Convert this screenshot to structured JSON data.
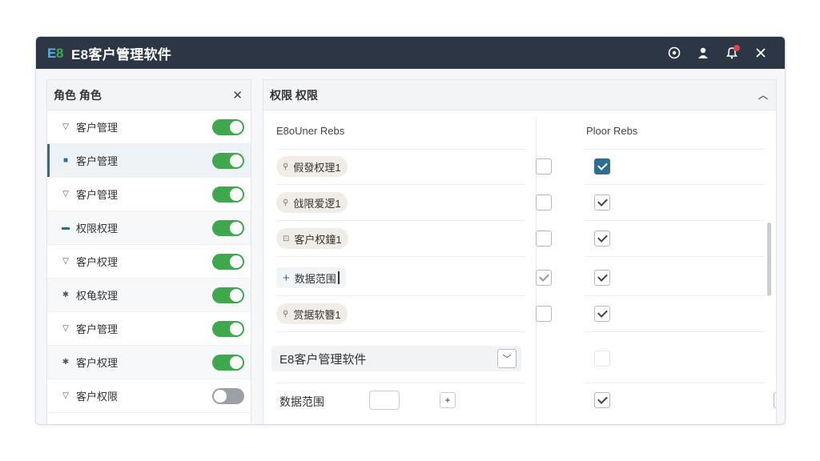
{
  "app": {
    "title": "E8客户管理软件",
    "logo_text": "E8"
  },
  "left_panel": {
    "header": "角色 角色",
    "close_icon": "close-icon",
    "roles": [
      {
        "label": "客户管理",
        "icon": "triangle-down-icon",
        "enabled": true
      },
      {
        "label": "客户管理",
        "icon": "square-icon",
        "enabled": true
      },
      {
        "label": "客户管理",
        "icon": "triangle-down-icon",
        "enabled": true
      },
      {
        "label": "权限权理",
        "icon": "flag-icon",
        "enabled": true
      },
      {
        "label": "客户权理",
        "icon": "triangle-down-icon",
        "enabled": true
      },
      {
        "label": "权龟软理",
        "icon": "star-icon",
        "enabled": true
      },
      {
        "label": "客户管理",
        "icon": "triangle-down-icon",
        "enabled": true
      },
      {
        "label": "客户权理",
        "icon": "star-icon",
        "enabled": true
      },
      {
        "label": "客户权限",
        "icon": "triangle-down-icon",
        "enabled": false
      }
    ]
  },
  "right_panel": {
    "header": "权限 权限",
    "col1_header": "E8oUner Rebs",
    "col2_header": "Ploor Rebs",
    "permissions": [
      {
        "label": "假發权理1",
        "icon": "user-icon",
        "col1_checked": false,
        "col2_checked": true
      },
      {
        "label": "戗限爱逻1",
        "icon": "user-icon",
        "col1_checked": false,
        "col2_checked": true
      },
      {
        "label": "客户权鐘1",
        "icon": "lock-icon",
        "col1_checked": false,
        "col2_checked": true
      },
      {
        "label": "数据范围",
        "icon": "plus-icon",
        "col1_checked": true,
        "col2_checked": true
      },
      {
        "label": "赏据软簪1",
        "icon": "user-icon",
        "col1_checked": false,
        "col2_checked": true
      }
    ],
    "section_label": "E8客户管理软件",
    "scope_label": "数据范围",
    "scope_input_value": "",
    "add_button": "+"
  },
  "colors": {
    "titlebar": "#2c3645",
    "toggle_on": "#3fa84d",
    "toggle_off": "#9ba0a6",
    "accent": "#2e6d8e"
  }
}
